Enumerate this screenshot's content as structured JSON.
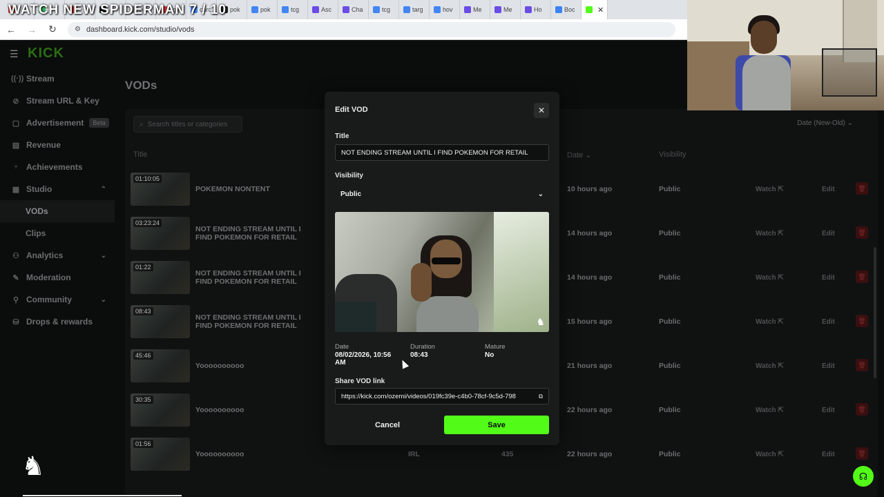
{
  "overlay_title": "WATCH NEW SPIDERMAN 7 / 10",
  "browser": {
    "tabs": [
      {
        "label": "",
        "color": "#d33"
      },
      {
        "label": "",
        "color": "#3b6"
      },
      {
        "label": "",
        "color": "#d33"
      },
      {
        "label": "",
        "color": "#111"
      },
      {
        "label": "cinc",
        "color": "#888"
      },
      {
        "label": "ege",
        "color": "#d33"
      },
      {
        "label": "carc",
        "color": "#4285f4"
      },
      {
        "label": "pok",
        "color": "#222"
      },
      {
        "label": "pok",
        "color": "#4285f4"
      },
      {
        "label": "tcg",
        "color": "#4285f4"
      },
      {
        "label": "Asc",
        "color": "#6b4de6"
      },
      {
        "label": "Cha",
        "color": "#6b4de6"
      },
      {
        "label": "tcg",
        "color": "#4285f4"
      },
      {
        "label": "targ",
        "color": "#4285f4"
      },
      {
        "label": "hov",
        "color": "#4285f4"
      },
      {
        "label": "Me",
        "color": "#6b4de6"
      },
      {
        "label": "Me",
        "color": "#6b4de6"
      },
      {
        "label": "Ho",
        "color": "#6b4de6"
      },
      {
        "label": "Boc",
        "color": "#3b82f6"
      }
    ],
    "active_tab_color": "#53fc18",
    "url": "dashboard.kick.com/studio/vods"
  },
  "logo": "KICK",
  "sidebar": {
    "items": [
      {
        "icon": "signal-icon",
        "glyph": "((·))",
        "label": "Stream"
      },
      {
        "icon": "link-icon",
        "glyph": "⊘",
        "label": "Stream URL & Key"
      },
      {
        "icon": "ad-icon",
        "glyph": "▢",
        "label": "Advertisement",
        "badge": "Beta"
      },
      {
        "icon": "revenue-icon",
        "glyph": "▤",
        "label": "Revenue"
      },
      {
        "icon": "trophy-icon",
        "glyph": "♆",
        "label": "Achievements"
      },
      {
        "icon": "studio-icon",
        "glyph": "▦",
        "label": "Studio",
        "chevron": "⌃"
      }
    ],
    "studio_sub": [
      {
        "label": "VODs",
        "active": true
      },
      {
        "label": "Clips",
        "active": false
      }
    ],
    "items_after": [
      {
        "icon": "analytics-icon",
        "glyph": "⚇",
        "label": "Analytics",
        "chevron": "⌄"
      },
      {
        "icon": "moderation-icon",
        "glyph": "✎",
        "label": "Moderation"
      },
      {
        "icon": "community-icon",
        "glyph": "⚲",
        "label": "Community",
        "chevron": "⌄"
      },
      {
        "icon": "drops-icon",
        "glyph": "⛁",
        "label": "Drops & rewards"
      }
    ]
  },
  "page": {
    "title": "VODs",
    "search_placeholder": "Search titles or categories",
    "sort_label": "Date (New-Old)",
    "columns": {
      "title": "Title",
      "date": "Date",
      "visibility": "Visibility"
    },
    "rows": [
      {
        "duration": "01:10:05",
        "title": "POKEMON NONTENT",
        "category": "",
        "views": "",
        "date": "10 hours ago",
        "visibility": "Public"
      },
      {
        "duration": "03:23:24",
        "title": "NOT ENDING STREAM UNTIL I FIND POKEMON FOR RETAIL",
        "category": "",
        "views": "",
        "date": "14 hours ago",
        "visibility": "Public"
      },
      {
        "duration": "01:22",
        "title": "NOT ENDING STREAM UNTIL I FIND POKEMON FOR RETAIL",
        "category": "",
        "views": "",
        "date": "14 hours ago",
        "visibility": "Public"
      },
      {
        "duration": "08:43",
        "title": "NOT ENDING STREAM UNTIL I FIND POKEMON FOR RETAIL",
        "category": "",
        "views": "",
        "date": "15 hours ago",
        "visibility": "Public"
      },
      {
        "duration": "45:46",
        "title": "Yoooooooooo",
        "category": "",
        "views": "",
        "date": "21 hours ago",
        "visibility": "Public"
      },
      {
        "duration": "30:35",
        "title": "Yoooooooooo",
        "category": "",
        "views": "",
        "date": "22 hours ago",
        "visibility": "Public"
      },
      {
        "duration": "01:56",
        "title": "Yoooooooooo",
        "category": "IRL",
        "views": "435",
        "date": "22 hours ago",
        "visibility": "Public"
      }
    ],
    "watch_label": "Watch ⇱",
    "edit_label": "Edit",
    "delete_glyph": "🗑"
  },
  "modal": {
    "title": "Edit VOD",
    "close_glyph": "✕",
    "title_label": "Title",
    "title_value": "NOT ENDING STREAM UNTIL I FIND POKEMON FOR RETAIL",
    "visibility_label": "Visibility",
    "visibility_value": "Public",
    "date_label": "Date",
    "date_value": "08/02/2026, 10:56 AM",
    "duration_label": "Duration",
    "duration_value": "08:43",
    "mature_label": "Mature",
    "mature_value": "No",
    "share_label": "Share VOD link",
    "share_value": "https://kick.com/ozemi/videos/019fc39e-c4b0-78cf-9c5d-798",
    "cancel_label": "Cancel",
    "save_label": "Save",
    "accent": "#53fc18"
  }
}
